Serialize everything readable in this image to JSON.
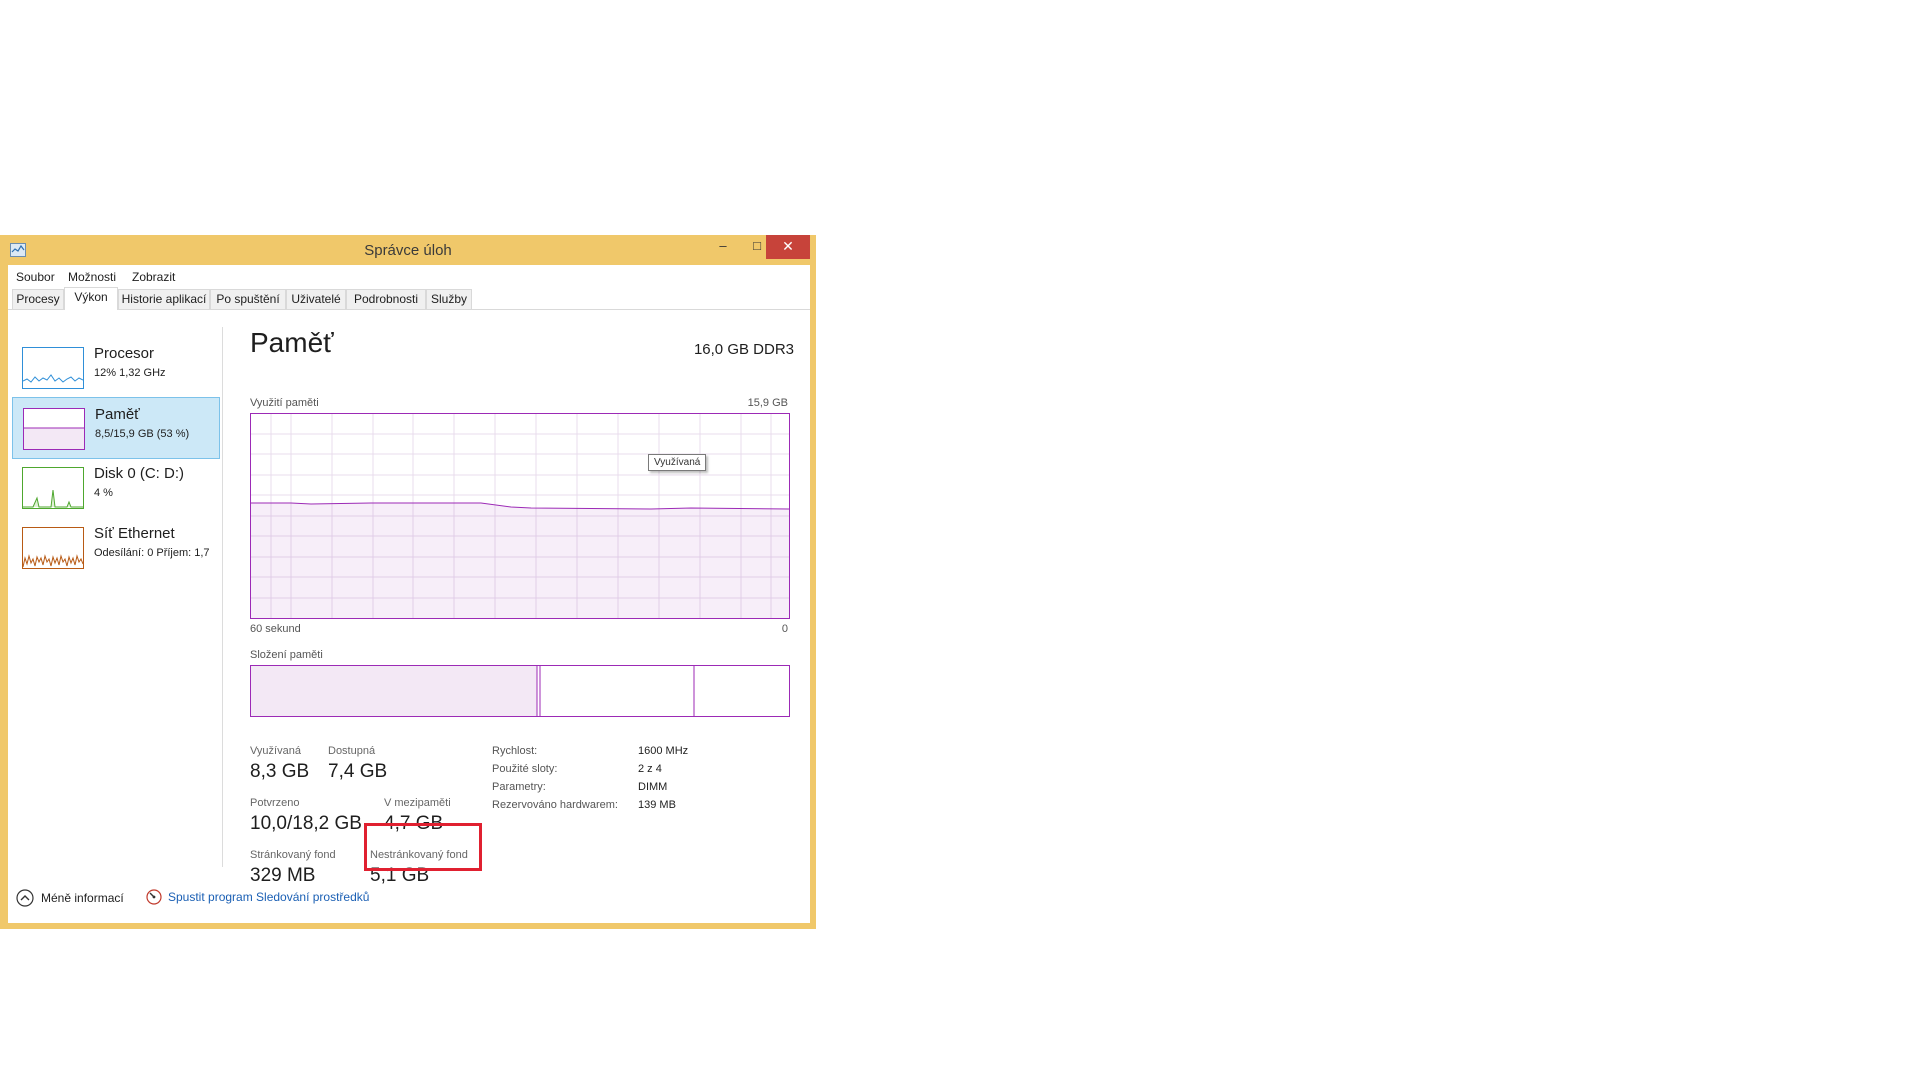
{
  "window": {
    "title": "Správce úloh",
    "min_label": "–",
    "max_label": "□",
    "close_label": "✕"
  },
  "menu": [
    "Soubor",
    "Možnosti",
    "Zobrazit"
  ],
  "tabs": [
    "Procesy",
    "Výkon",
    "Historie aplikací",
    "Po spuštění",
    "Uživatelé",
    "Podrobnosti",
    "Služby"
  ],
  "active_tab": "Výkon",
  "sidebar": {
    "items": [
      {
        "title": "Procesor",
        "subtitle": "12% 1,32 GHz",
        "color": "#2f8fd8"
      },
      {
        "title": "Paměť",
        "subtitle": "8,5/15,9 GB (53 %)",
        "color": "#9c2ab6"
      },
      {
        "title": "Disk 0 (C: D:)",
        "subtitle": "4 %",
        "color": "#4ea72e"
      },
      {
        "title": "Síť Ethernet",
        "subtitle": "Odesílání: 0 Příjem: 1,7",
        "color": "#b85a14"
      }
    ]
  },
  "main": {
    "title": "Paměť",
    "spec": "16,0 GB DDR3",
    "usage_label": "Využití paměti",
    "usage_max": "15,9 GB",
    "time_left": "60 sekund",
    "time_right": "0",
    "tooltip": "Využívaná",
    "composition_label": "Složení paměti",
    "stats": {
      "in_use": {
        "label": "Využívaná",
        "value": "8,3 GB"
      },
      "available": {
        "label": "Dostupná",
        "value": "7,4 GB"
      },
      "committed": {
        "label": "Potvrzeno",
        "value": "10,0/18,2 GB"
      },
      "cached": {
        "label": "V mezipaměti",
        "value": "4,7 GB"
      },
      "paged_pool": {
        "label": "Stránkovaný fond",
        "value": "329 MB"
      },
      "non_paged_pool": {
        "label": "Nestránkovaný fond",
        "value": "5,1 GB"
      }
    },
    "details": [
      {
        "label": "Rychlost:",
        "value": "1600 MHz"
      },
      {
        "label": "Použité sloty:",
        "value": "2 z 4"
      },
      {
        "label": "Parametry:",
        "value": "DIMM"
      },
      {
        "label": "Rezervováno hardwarem:",
        "value": "139 MB"
      }
    ]
  },
  "footer": {
    "less_info": "Méně informací",
    "open_monitor": "Spustit program Sledování prostředků"
  },
  "colors": {
    "window_border": "#f0c86a",
    "memory_accent": "#9c2ab6",
    "highlight": "#e02030",
    "link": "#1a5fb4"
  }
}
